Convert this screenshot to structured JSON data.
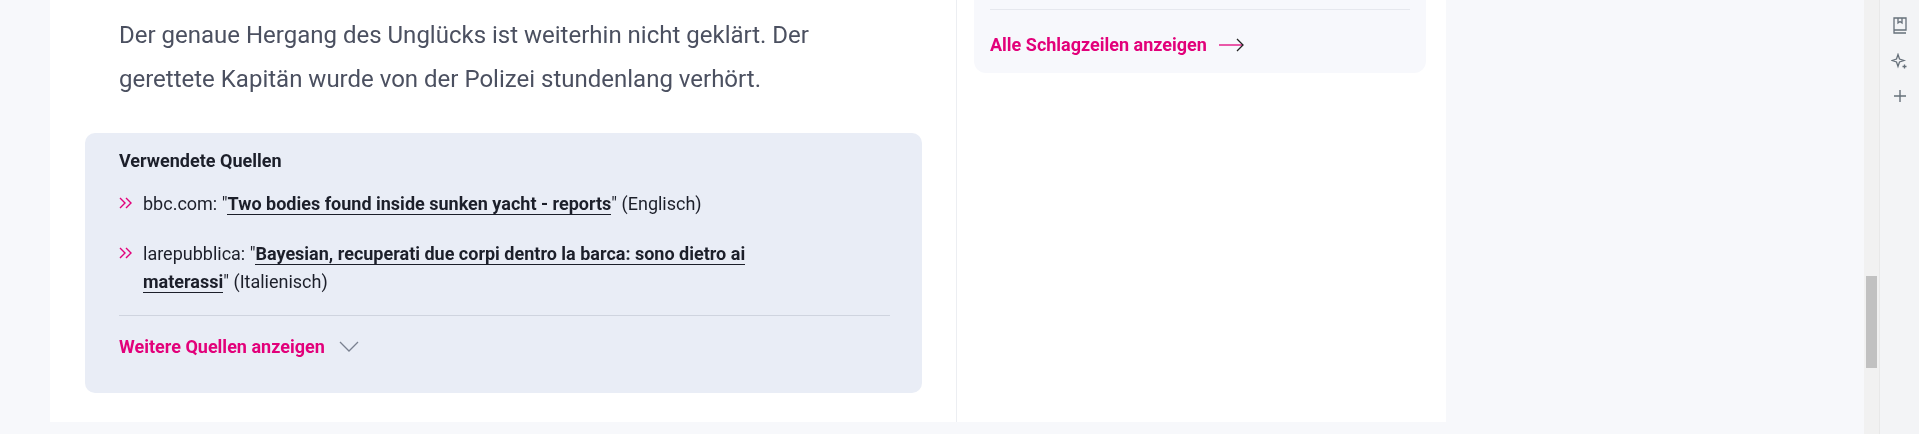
{
  "article": {
    "paragraph": "Der genaue Hergang des Unglücks ist weiterhin nicht geklärt. Der gerettete Kapitän wurde von der Polizei stundenlang verhört.",
    "sources": {
      "title": "Verwendete Quellen",
      "items": [
        {
          "prefix": "bbc.com: \"",
          "link_lines": [
            "Two bodies found inside sunken yacht - reports"
          ],
          "suffix": "\" (Englisch)"
        },
        {
          "prefix": "larepubblica: \"",
          "link_lines": [
            "Bayesian, recuperati due corpi dentro la barca: sono dietro ai",
            "materassi"
          ],
          "suffix": "\" (Italienisch)"
        }
      ],
      "more_link": {
        "label": "Weitere Quellen anzeigen",
        "expanded": false
      }
    }
  },
  "sidebar": {
    "headlines_link": "Alle Schlagzeilen anzeigen"
  }
}
